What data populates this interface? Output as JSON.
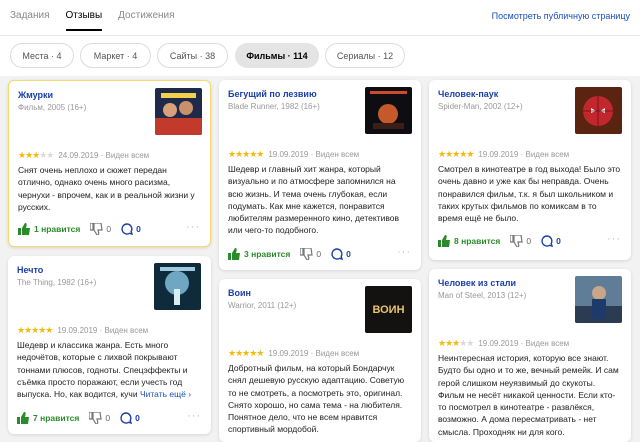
{
  "tabs": [
    {
      "label": "Задания",
      "active": false
    },
    {
      "label": "Отзывы",
      "active": true
    },
    {
      "label": "Достижения",
      "active": false
    }
  ],
  "public_link": "Посмотреть публичную страницу",
  "filters": [
    {
      "label": "Места · 4",
      "active": false
    },
    {
      "label": "Маркет · 4",
      "active": false
    },
    {
      "label": "Сайты · 38",
      "active": false
    },
    {
      "label": "Фильмы · 114",
      "active": true
    },
    {
      "label": "Сериалы · 12",
      "active": false
    }
  ],
  "colors": {
    "link": "#1a4fbf",
    "star": "#f5b90a",
    "like": "#2b8a2b",
    "highlight": "#f6d86c"
  },
  "reviews": [
    {
      "title": "Жмурки",
      "subtitle": "Фильм, 2005 (16+)",
      "stars": 3,
      "date": "24.09.2019 · Виден всем",
      "text": "Снят очень неплохо и сюжет передан отлично, однако очень много расизма, чернухи - впрочем, как и в реальной жизни у русских.",
      "likes": "1 нравится",
      "dislikes": "0",
      "comments": "0",
      "poster": "zhmurki-poster"
    },
    {
      "title": "Нечто",
      "subtitle": "The Thing, 1982 (16+)",
      "stars": 5,
      "date": "19.09.2019 · Виден всем",
      "text": "Шедевр и классика жанра. Есть много недочётов, которые с лихвой покрывают тоннами плюсов, годноты. Спецэффекты и съёмка просто поражают, если учесть год выпуска. Но, как водится, кучи",
      "read_more": "Читать ещё ›",
      "likes": "7 нравится",
      "dislikes": "0",
      "comments": "0",
      "poster": "the-thing-poster"
    },
    {
      "title": "Бегущий по лезвию",
      "subtitle": "Blade Runner, 1982 (16+)",
      "stars": 5,
      "date": "19.09.2019 · Виден всем",
      "text": "Шедевр и главный хит жанра, который визуально и по атмосфере запомнился на всю жизнь. И тема очень глубокая, если подумать. Как мне кажется, понравится любителям размеренного кино, детективов или чего-то подобного.",
      "likes": "3 нравится",
      "dislikes": "0",
      "comments": "0",
      "poster": "blade-runner-poster"
    },
    {
      "title": "Воин",
      "subtitle": "Warrior, 2011 (12+)",
      "stars": 5,
      "date": "19.09.2019 · Виден всем",
      "text": "Добротный фильм, на который Бондарчук снял дешевую русскую адаптацию. Советую то не смотреть, а посмотреть это, оригинал. Снято хорошо, но сама тема - на любителя. Понятное дело, что не всем нравится спортивный мордобой.",
      "poster": "warrior-poster",
      "poster_text": "ВОИН"
    },
    {
      "title": "Человек-паук",
      "subtitle": "Spider-Man, 2002 (12+)",
      "stars": 5,
      "date": "19.09.2019 · Виден всем",
      "text": "Смотрел в кинотеатре в год выхода! Было это очень давно и уже как бы неправда. Очень понравился фильм, т.к. я был школьником и таких крутых фильмов по комиксам в то время ещё не было.",
      "likes": "8 нравится",
      "dislikes": "0",
      "comments": "0",
      "poster": "spider-man-poster"
    },
    {
      "title": "Человек из стали",
      "subtitle": "Man of Steel, 2013 (12+)",
      "stars": 3,
      "date": "19.09.2019 · Виден всем",
      "text": "Неинтересная история, которую все знают. Будто бы одно и то же, вечный ремейк. И сам герой слишком неуязвимый до скукоты. Фильм не несёт никакой ценности. Если кто-то посмотрел в кинотеатре - развлёкся, возможно. А дома пересматривать - нет смысла. Проходняк ни для кого.",
      "poster": "man-of-steel-poster"
    }
  ]
}
